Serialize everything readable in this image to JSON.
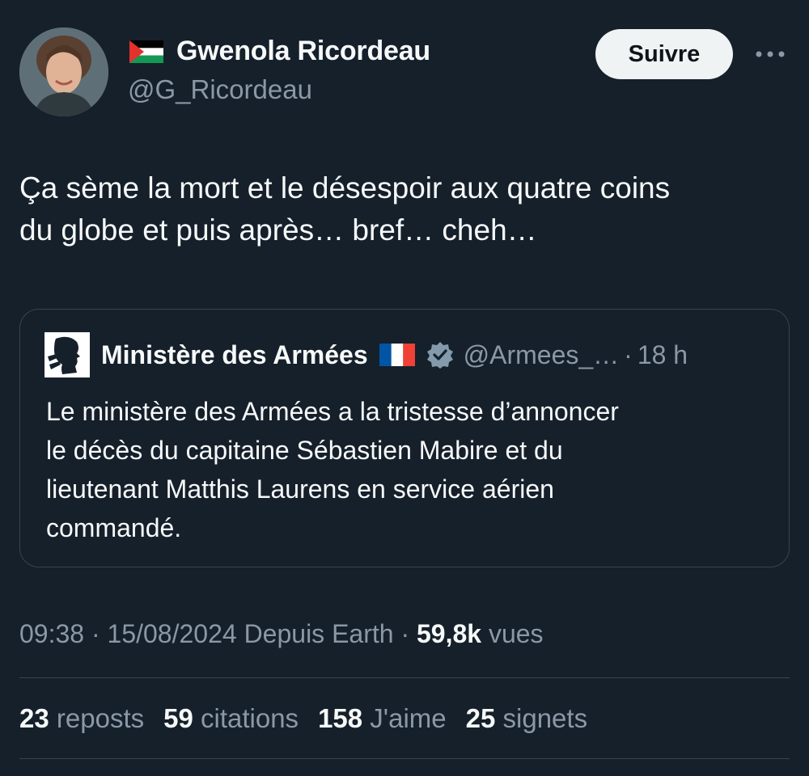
{
  "author": {
    "display_name": "Gwenola Ricordeau",
    "handle": "@G_Ricordeau",
    "flag_icon": "palestine-flag-icon"
  },
  "follow_label": "Suivre",
  "tweet": {
    "text_line1": "Ça sème la mort et le désespoir aux quatre coins",
    "text_line2": "du globe et puis après… bref… cheh…"
  },
  "quote": {
    "name": "Ministère des Armées",
    "handle": "@Armees_…",
    "separator": "·",
    "time": "18 h",
    "text_line1": "Le ministère des Armées a la tristesse d’annoncer",
    "text_line2": "le décès du capitaine Sébastien Mabire et du",
    "text_line3": "lieutenant Matthis Laurens en service aérien",
    "text_line4": "commandé."
  },
  "meta": {
    "time": "09:38",
    "sep1": "·",
    "date": "15/08/2024",
    "source": "Depuis Earth",
    "sep2": "·",
    "views_count": "59,8k",
    "views_label": "vues"
  },
  "stats": [
    {
      "count": "23",
      "label": "reposts"
    },
    {
      "count": "59",
      "label": "citations"
    },
    {
      "count": "158",
      "label": "J'aime"
    },
    {
      "count": "25",
      "label": "signets"
    }
  ],
  "colors": {
    "background": "#15202b",
    "text_primary": "#f7f9f9",
    "text_secondary": "#8b98a5",
    "border": "#38444d",
    "button_bg": "#eff3f4",
    "verified": "#829aab"
  }
}
